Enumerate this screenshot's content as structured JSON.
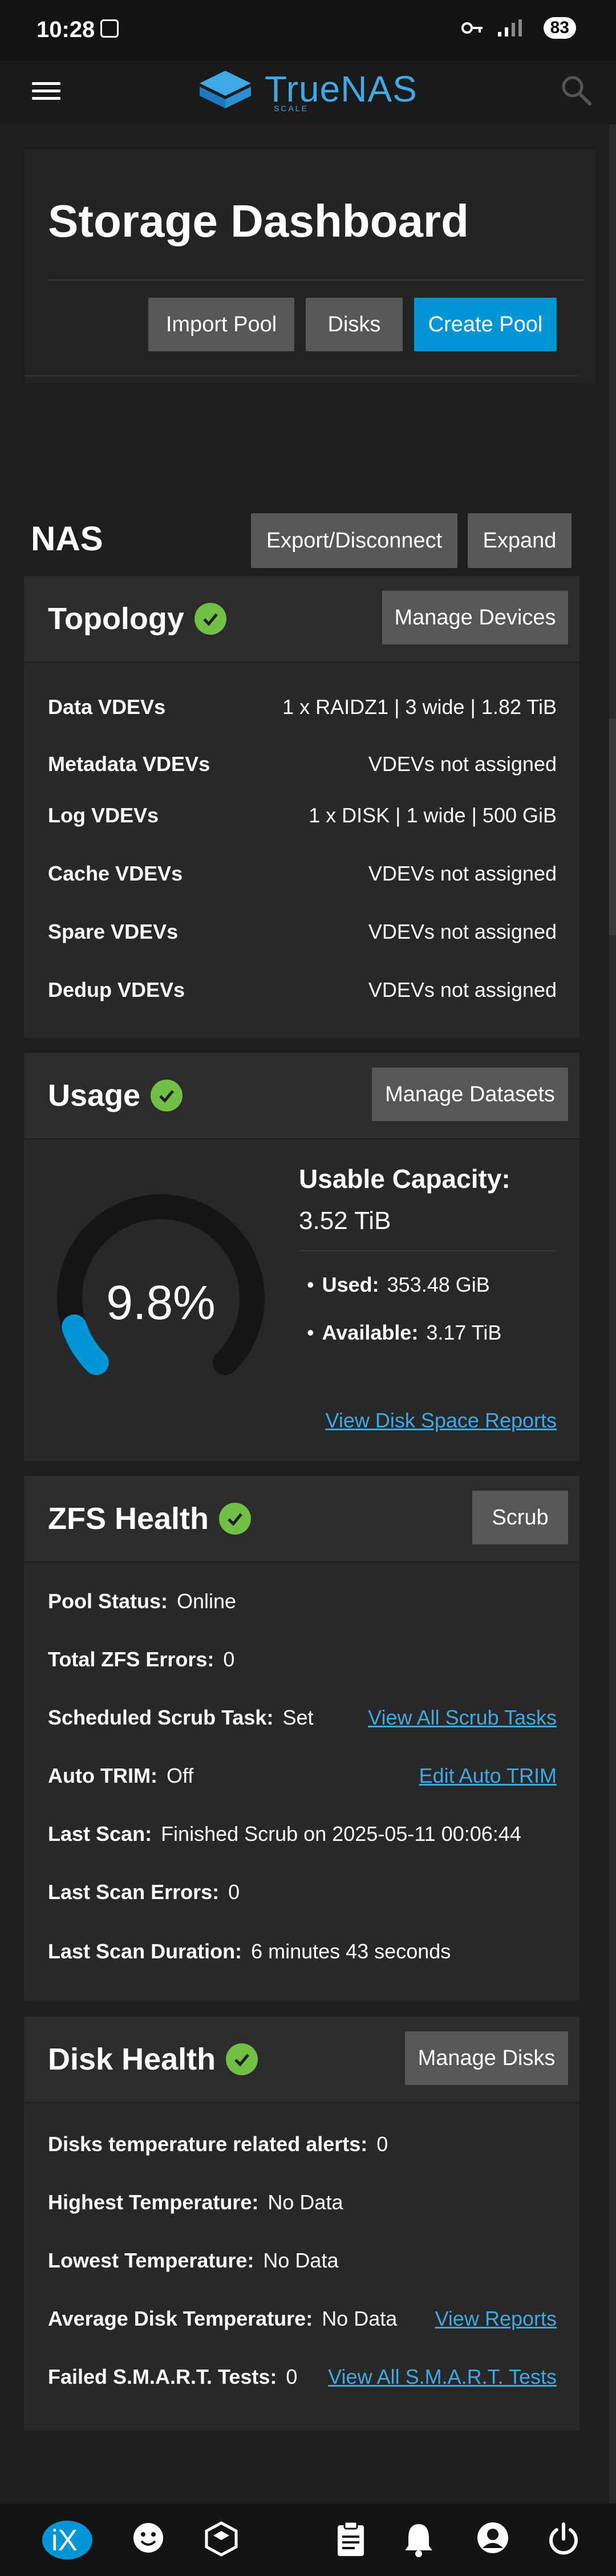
{
  "status_bar": {
    "time": "10:28",
    "battery": "83"
  },
  "app": {
    "brand": "TrueNAS",
    "edition": "SCALE"
  },
  "header": {
    "title": "Storage Dashboard",
    "import_pool": "Import Pool",
    "disks": "Disks",
    "create_pool": "Create Pool"
  },
  "pool": {
    "name": "NAS",
    "export_label": "Export/Disconnect",
    "expand_label": "Expand"
  },
  "topology": {
    "title": "Topology",
    "action": "Manage Devices",
    "rows": [
      {
        "label": "Data VDEVs",
        "value": "1 x RAIDZ1 | 3 wide | 1.82 TiB"
      },
      {
        "label": "Metadata VDEVs",
        "value": "VDEVs not assigned"
      },
      {
        "label": "Log VDEVs",
        "value": "1 x DISK | 1 wide | 500 GiB"
      },
      {
        "label": "Cache VDEVs",
        "value": "VDEVs not assigned"
      },
      {
        "label": "Spare VDEVs",
        "value": "VDEVs not assigned"
      },
      {
        "label": "Dedup VDEVs",
        "value": "VDEVs not assigned"
      }
    ]
  },
  "usage": {
    "title": "Usage",
    "action": "Manage Datasets",
    "percent_text": "9.8%",
    "percent": 9.8,
    "capacity_label": "Usable Capacity:",
    "capacity_value": "3.52 TiB",
    "used_label": "Used:",
    "used_value": "353.48 GiB",
    "available_label": "Available:",
    "available_value": "3.17 TiB",
    "reports_link": "View Disk Space Reports"
  },
  "zfs": {
    "title": "ZFS Health",
    "action": "Scrub",
    "pool_status_label": "Pool Status:",
    "pool_status_value": "Online",
    "errors_label": "Total ZFS Errors:",
    "errors_value": "0",
    "scrub_task_label": "Scheduled Scrub Task:",
    "scrub_task_value": "Set",
    "scrub_link": "View All Scrub Tasks",
    "trim_label": "Auto TRIM:",
    "trim_value": "Off",
    "trim_link": "Edit Auto TRIM",
    "last_scan_label": "Last Scan:",
    "last_scan_value": "Finished Scrub on 2025-05-11 00:06:44",
    "scan_errors_label": "Last Scan Errors:",
    "scan_errors_value": "0",
    "scan_duration_label": "Last Scan Duration:",
    "scan_duration_value": "6 minutes 43 seconds"
  },
  "disk": {
    "title": "Disk Health",
    "action": "Manage Disks",
    "temp_alerts_label": "Disks temperature related alerts:",
    "temp_alerts_value": "0",
    "highest_label": "Highest Temperature:",
    "highest_value": "No Data",
    "lowest_label": "Lowest Temperature:",
    "lowest_value": "No Data",
    "average_label": "Average Disk Temperature:",
    "average_value": "No Data",
    "reports_link": "View Reports",
    "smart_label": "Failed S.M.A.R.T. Tests:",
    "smart_value": "0",
    "smart_link": "View All S.M.A.R.T. Tests"
  },
  "colors": {
    "accent": "#0095d5",
    "link": "#3fa9e6",
    "ok": "#71bf44",
    "gauge_track": "#151515",
    "gauge_fill": "#0095d5"
  }
}
